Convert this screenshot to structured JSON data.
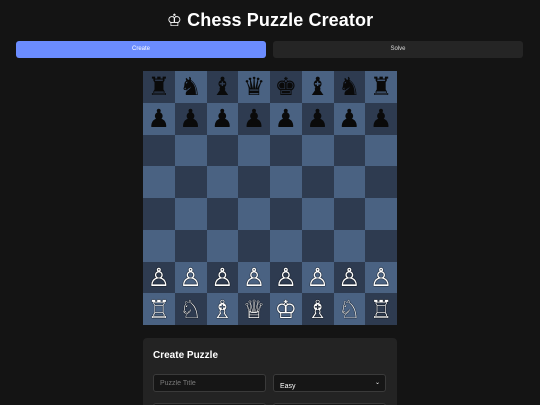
{
  "header": {
    "icon": "crown-icon",
    "icon_glyph": "♔",
    "title": "Chess Puzzle Creator"
  },
  "tabs": [
    {
      "label": "Create",
      "active": true
    },
    {
      "label": "Solve",
      "active": false
    }
  ],
  "colors": {
    "accent": "#6b8cff",
    "background": "#141414",
    "light_square": "#4a6282",
    "dark_square": "#2e3b50",
    "panel": "#232323"
  },
  "board": {
    "ranks": [
      [
        "♜",
        "♞",
        "♝",
        "♛",
        "♚",
        "♝",
        "♞",
        "♜"
      ],
      [
        "♟",
        "♟",
        "♟",
        "♟",
        "♟",
        "♟",
        "♟",
        "♟"
      ],
      [
        "",
        "",
        "",
        "",
        "",
        "",
        "",
        ""
      ],
      [
        "",
        "",
        "",
        "",
        "",
        "",
        "",
        ""
      ],
      [
        "",
        "",
        "",
        "",
        "",
        "",
        "",
        ""
      ],
      [
        "",
        "",
        "",
        "",
        "",
        "",
        "",
        ""
      ],
      [
        "♙",
        "♙",
        "♙",
        "♙",
        "♙",
        "♙",
        "♙",
        "♙"
      ],
      [
        "♖",
        "♘",
        "♗",
        "♕",
        "♔",
        "♗",
        "♘",
        "♖"
      ]
    ]
  },
  "create_panel": {
    "heading": "Create Puzzle",
    "title_input": {
      "placeholder": "Puzzle Title",
      "value": ""
    },
    "difficulty_select": {
      "selected": "Easy",
      "icon": "chevron-down-icon",
      "chevron_glyph": "⌄"
    }
  }
}
